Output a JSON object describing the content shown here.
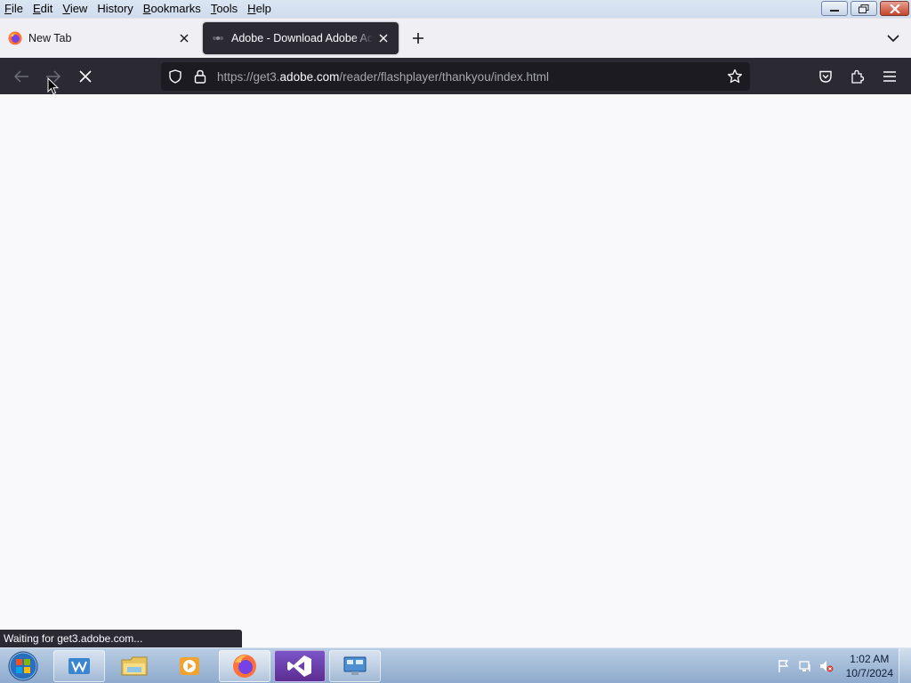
{
  "menu": {
    "items": [
      {
        "key": "F",
        "rest": "ile"
      },
      {
        "key": "E",
        "rest": "dit"
      },
      {
        "key": "V",
        "rest": "iew"
      },
      {
        "key": "H",
        "rest": "istory"
      },
      {
        "key": "B",
        "rest": "ookmarks"
      },
      {
        "key": "T",
        "rest": "ools"
      },
      {
        "key": "H",
        "rest": "elp"
      }
    ]
  },
  "tabs": [
    {
      "title": "New Tab"
    },
    {
      "title": "Adobe - Download Adobe Acrobat Reader"
    }
  ],
  "toolbar": {
    "url_prefix": "https://get3.",
    "url_domain": "adobe.com",
    "url_path": "/reader/flashplayer/thankyou/index.html"
  },
  "status": {
    "text": "Waiting for get3.adobe.com..."
  },
  "clock": {
    "time": "1:02 AM",
    "date": "10/7/2024"
  },
  "colors": {
    "toolbar": "#2b2a33",
    "urlbar": "#1c1b22",
    "content": "#f9f9fb",
    "taskbar": "#8eaacc"
  }
}
